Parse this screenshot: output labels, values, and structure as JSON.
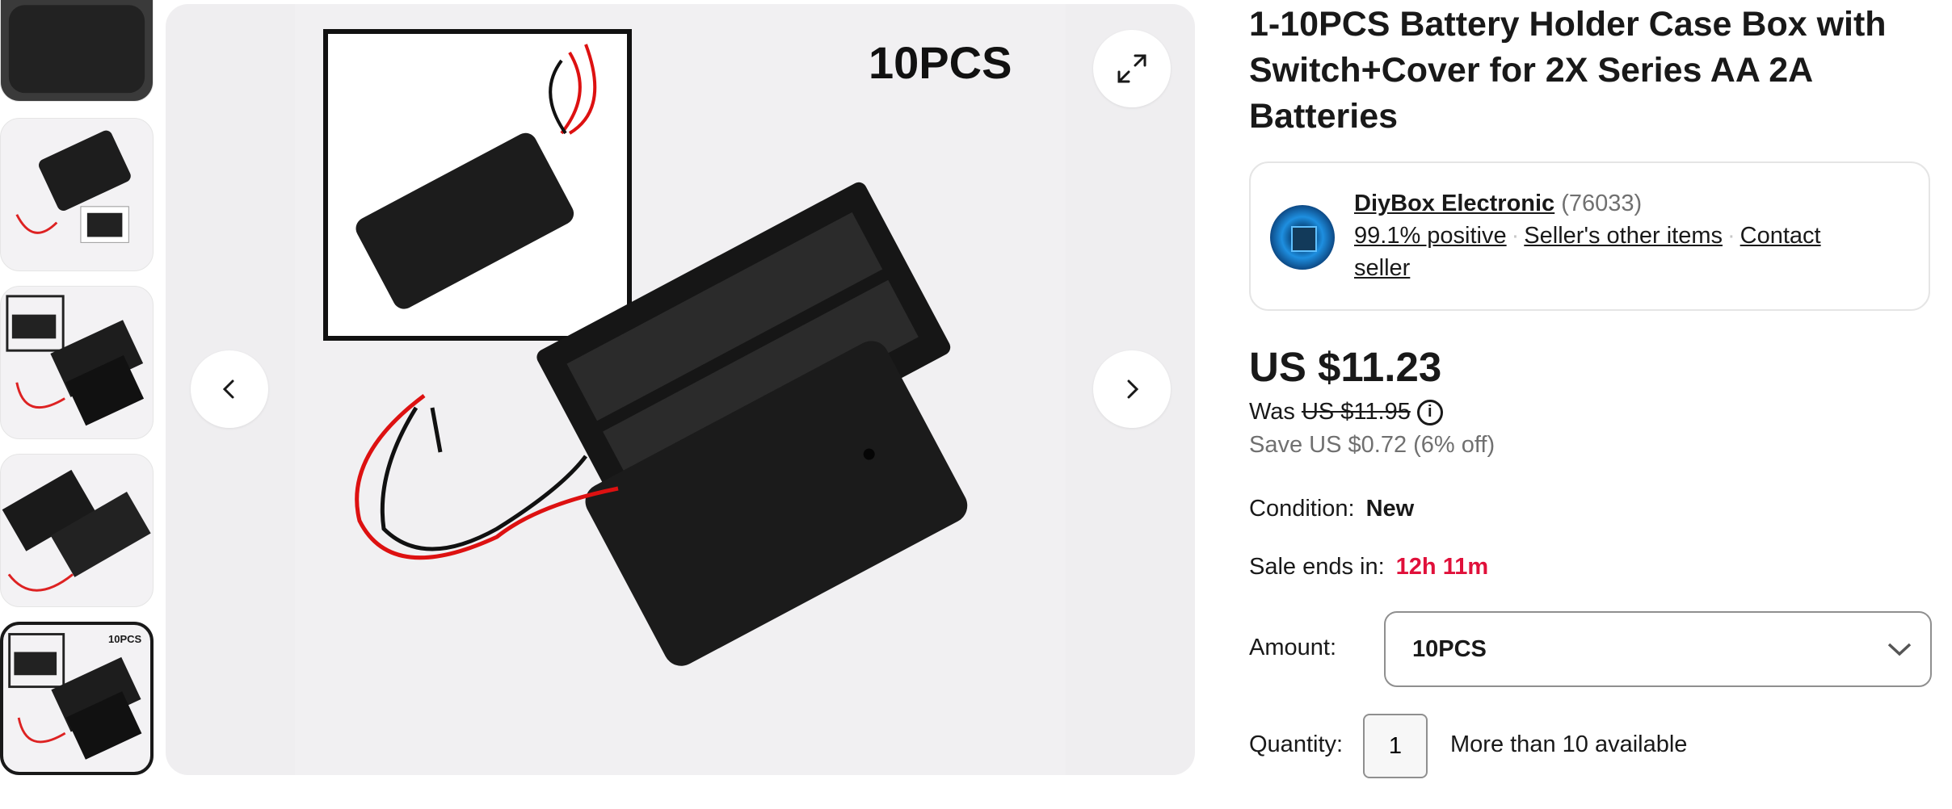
{
  "gallery": {
    "badge": "10PCS",
    "thumbnails": [
      {
        "label": "thumbnail 1"
      },
      {
        "label": "thumbnail 2"
      },
      {
        "label": "thumbnail 3"
      },
      {
        "label": "thumbnail 4"
      },
      {
        "label": "thumbnail 5",
        "badge": "10PCS",
        "selected": true
      }
    ],
    "icons": {
      "prev": "chevron-left-icon",
      "next": "chevron-right-icon",
      "expand": "expand-icon"
    }
  },
  "product": {
    "title": "1-10PCS Battery Holder Case Box with Switch+Cover for 2X Series AA 2A Batteries",
    "seller": {
      "name": "DiyBox Electronic",
      "count": "(76033)",
      "positive": "99.1% positive",
      "other_items": "Seller's other items",
      "contact": "Contact seller"
    },
    "price": "US $11.23",
    "was_label": "Was",
    "was_price": "US $11.95",
    "save": "Save US $0.72 (6% off)",
    "condition_label": "Condition:",
    "condition": "New",
    "sale_label": "Sale ends in:",
    "sale_time": "12h 11m",
    "amount_label": "Amount:",
    "amount": "10PCS",
    "quantity_label": "Quantity:",
    "quantity": "1",
    "availability": "More than 10 available"
  },
  "colors": {
    "sale": "#e0103a",
    "text": "#191919",
    "muted": "#707070"
  }
}
